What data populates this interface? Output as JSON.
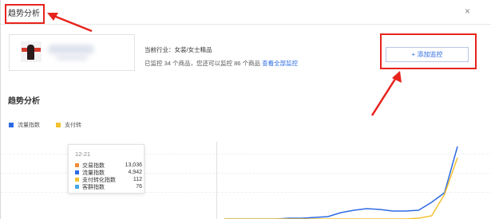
{
  "window": {
    "title": "趋势分析",
    "close_glyph": "×"
  },
  "shop": {
    "industry_label": "当前行业：女装/女士精品",
    "monitor_text_prefix": "已监控",
    "monitored_count": "34",
    "monitor_text_middle": "个商品，您还可以监控",
    "remaining_count": "86",
    "monitor_text_suffix": "个商品",
    "view_all_link": "查看全部监控",
    "add_button_label": "+ 添加监控"
  },
  "section_title": "趋势分析",
  "legend": [
    {
      "label": "流量指数",
      "color": "#2d6ae3"
    },
    {
      "label": "支付转",
      "color": "#f2c230"
    }
  ],
  "tooltip": {
    "date": "12-21",
    "rows": [
      {
        "label": "交易指数",
        "value": "13,036",
        "color": "#f08c3a"
      },
      {
        "label": "流量指数",
        "value": "4,942",
        "color": "#2d6ae3"
      },
      {
        "label": "支付转化指数",
        "value": "112",
        "color": "#f2c230"
      },
      {
        "label": "客群指数",
        "value": "76",
        "color": "#45a6e8"
      }
    ]
  },
  "chart_data": {
    "type": "line",
    "title": "",
    "series": [
      {
        "name": "流量指数",
        "values": [
          0,
          0,
          0,
          0,
          0,
          1,
          1,
          2,
          3,
          8,
          11,
          13,
          12,
          10,
          10,
          11,
          21,
          33,
          91
        ]
      },
      {
        "name": "支付转",
        "values": [
          0,
          0,
          0,
          0,
          0,
          0,
          0,
          0,
          0,
          0,
          0,
          0,
          0,
          0,
          0,
          1,
          4,
          31,
          77
        ]
      }
    ],
    "ylim": [
      0,
      100
    ],
    "grid": true
  },
  "colors": {
    "accent": "#2d6ae3",
    "callout": "#e8231d"
  }
}
